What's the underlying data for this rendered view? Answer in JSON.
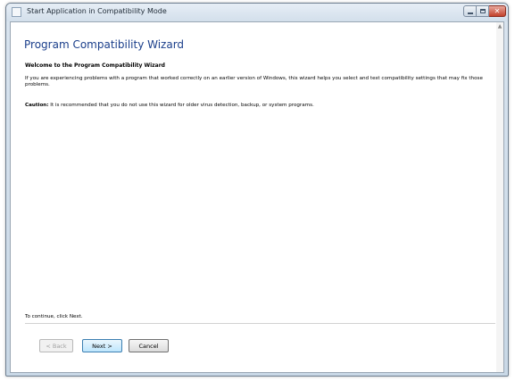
{
  "window": {
    "title": "Start Application in Compatibility Mode"
  },
  "wizard": {
    "heading": "Program Compatibility Wizard",
    "subheading": "Welcome to the Program Compatibility Wizard",
    "description": "If you are experiencing problems with a program that worked correctly on an earlier version of Windows, this wizard helps you select and test compatibility settings that may fix those problems.",
    "caution_label": "Caution:",
    "caution_text": " It is recommended that you do not use this wizard for older virus detection, backup, or system programs.",
    "continue_text": "To continue, click Next."
  },
  "buttons": {
    "back_label": "< Back",
    "next_label": "Next >",
    "cancel_label": "Cancel"
  },
  "colors": {
    "heading": "#1b3f8b",
    "close_button": "#c2412b"
  }
}
